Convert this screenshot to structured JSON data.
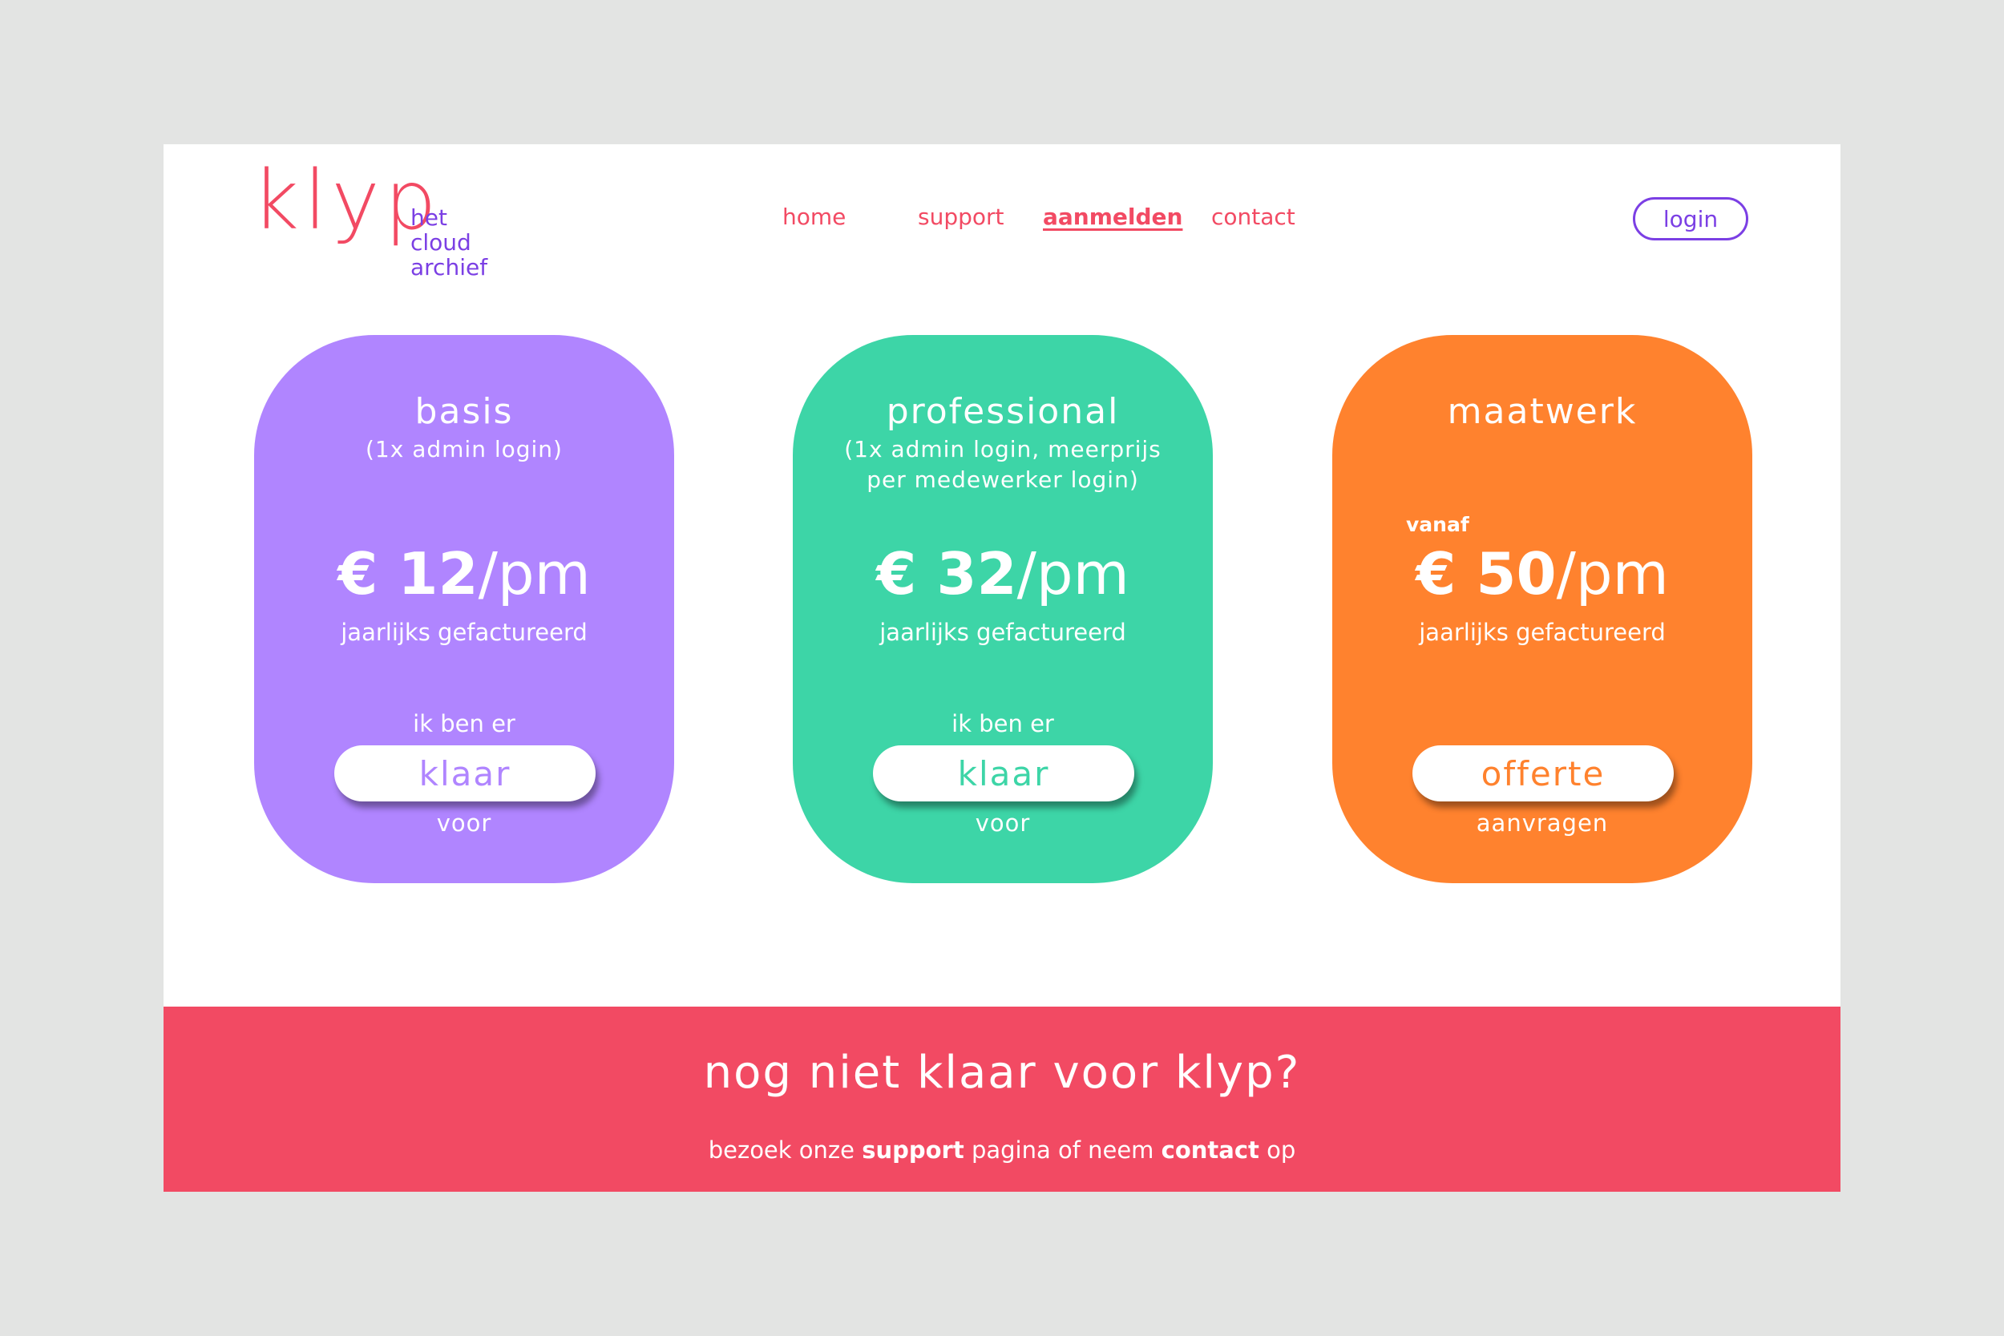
{
  "brand": {
    "logo": "klyp",
    "tagline": [
      "het",
      "cloud",
      "archief"
    ]
  },
  "nav": {
    "items": [
      {
        "label": "home"
      },
      {
        "label": "support"
      },
      {
        "label": "aanmelden",
        "active": true
      },
      {
        "label": "contact"
      }
    ],
    "login_label": "login"
  },
  "plans": [
    {
      "title": "basis",
      "subtitle_lines": [
        "(1x admin login)"
      ],
      "price_prefix": "",
      "price_amount": "€ 12",
      "price_unit": "/pm",
      "billing": "jaarlijks gefactureerd",
      "cta_above": "ik ben er",
      "cta_label": "klaar",
      "cta_below": "voor"
    },
    {
      "title": "professional",
      "subtitle_lines": [
        "(1x admin login, meerprijs",
        "per medewerker login)"
      ],
      "price_prefix": "",
      "price_amount": "€ 32",
      "price_unit": "/pm",
      "billing": "jaarlijks gefactureerd",
      "cta_above": "ik ben er",
      "cta_label": "klaar",
      "cta_below": "voor"
    },
    {
      "title": "maatwerk",
      "subtitle_lines": [],
      "price_prefix": "vanaf",
      "price_amount": "€ 50",
      "price_unit": "/pm",
      "billing": "jaarlijks gefactureerd",
      "cta_above": "",
      "cta_label": "offerte",
      "cta_below": "aanvragen"
    }
  ],
  "banner": {
    "headline": "nog niet klaar voor klyp?",
    "line_pre": "bezoek onze",
    "line_link1": "support",
    "line_mid": "pagina of neem",
    "line_link2": "contact",
    "line_post": "op"
  },
  "colors": {
    "brand_red": "#f24a63",
    "brand_purple": "#7b3fe4",
    "basis": "#b085ff",
    "professional": "#3dd5a7",
    "maatwerk": "#ff822e",
    "background": "#e3e4e3"
  }
}
